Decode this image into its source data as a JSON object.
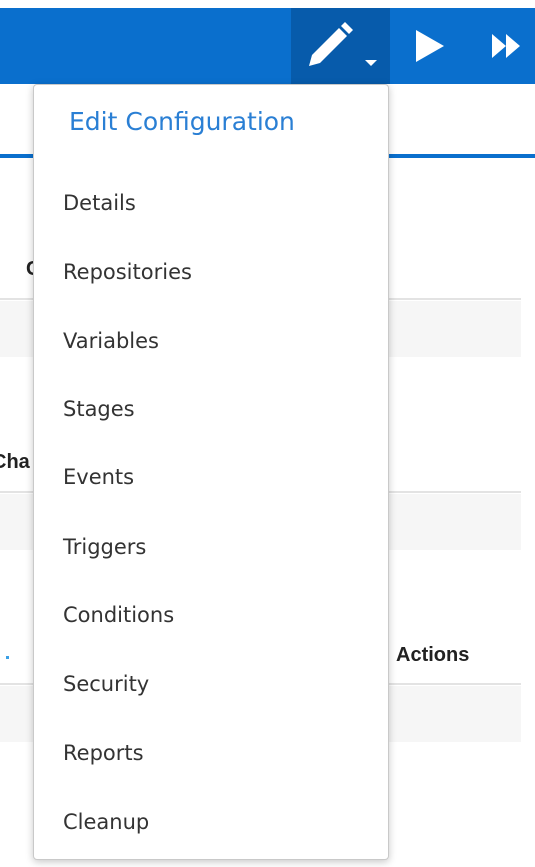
{
  "toolbar": {
    "edit_icon": "pencil-icon",
    "dropdown_icon": "caret-down-icon",
    "run_icon": "play-icon",
    "run_all_icon": "fast-forward-icon"
  },
  "background": {
    "fragment_c": "C",
    "fragment_cha": "Cha",
    "actions_header": "Actions"
  },
  "menu": {
    "title": "Edit Configuration",
    "items": [
      {
        "label": "Details"
      },
      {
        "label": "Repositories"
      },
      {
        "label": "Variables"
      },
      {
        "label": "Stages"
      },
      {
        "label": "Events"
      },
      {
        "label": "Triggers"
      },
      {
        "label": "Conditions"
      },
      {
        "label": "Security"
      },
      {
        "label": "Reports"
      },
      {
        "label": "Cleanup"
      }
    ]
  },
  "colors": {
    "toolbar": "#0a6fcd",
    "toolbar_active": "#075bab",
    "title_accent": "#2a7fd4"
  }
}
